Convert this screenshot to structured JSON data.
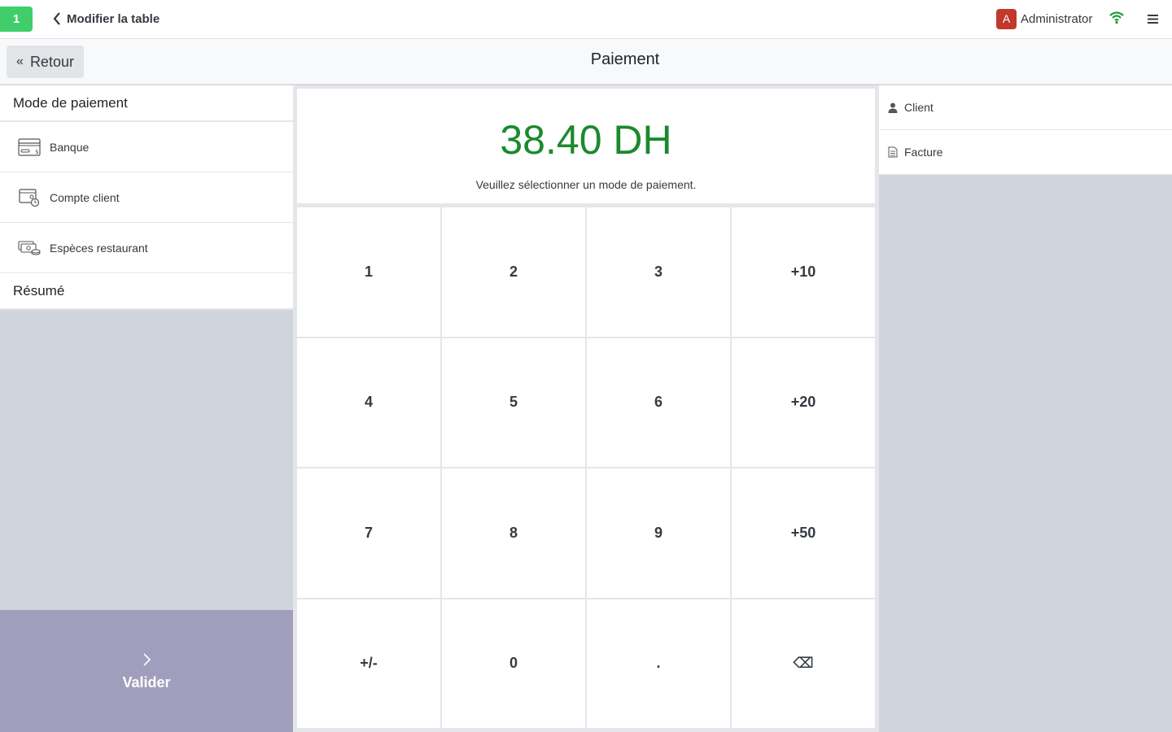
{
  "navbar": {
    "table_number": "1",
    "back_table_label": "Modifier la table",
    "user_initial": "A",
    "user_name": "Administrator",
    "colors": {
      "badge": "#3fce6a",
      "avatar": "#c0392b",
      "wifi": "#1a9a34"
    },
    "icons": [
      "chevron-left-icon",
      "wifi-icon",
      "hamburger-menu-icon"
    ]
  },
  "subheader": {
    "back_label": "Retour",
    "title": "Paiement",
    "icons": [
      "double-chevron-left-icon"
    ]
  },
  "left_panel": {
    "payment_methods_title": "Mode de paiement",
    "payment_methods": [
      {
        "label": "Banque",
        "icon": "bank-card-icon"
      },
      {
        "label": "Compte client",
        "icon": "customer-account-icon"
      },
      {
        "label": "Espèces restaurant",
        "icon": "cash-icon"
      }
    ],
    "summary_title": "Résumé",
    "validate_label": "Valider",
    "colors": {
      "validate_bg": "#a19ebd"
    }
  },
  "center": {
    "amount": "38.40 DH",
    "hint": "Veuillez sélectionner un mode de paiement.",
    "amount_color": "#1a8a2e",
    "keys": [
      "1",
      "2",
      "3",
      "+10",
      "4",
      "5",
      "6",
      "+20",
      "7",
      "8",
      "9",
      "+50",
      "+/-",
      "0",
      ".",
      "⌫"
    ]
  },
  "right_panel": {
    "customer_label": "Client",
    "invoice_label": "Facture",
    "icons": [
      "user-icon",
      "document-icon"
    ]
  }
}
